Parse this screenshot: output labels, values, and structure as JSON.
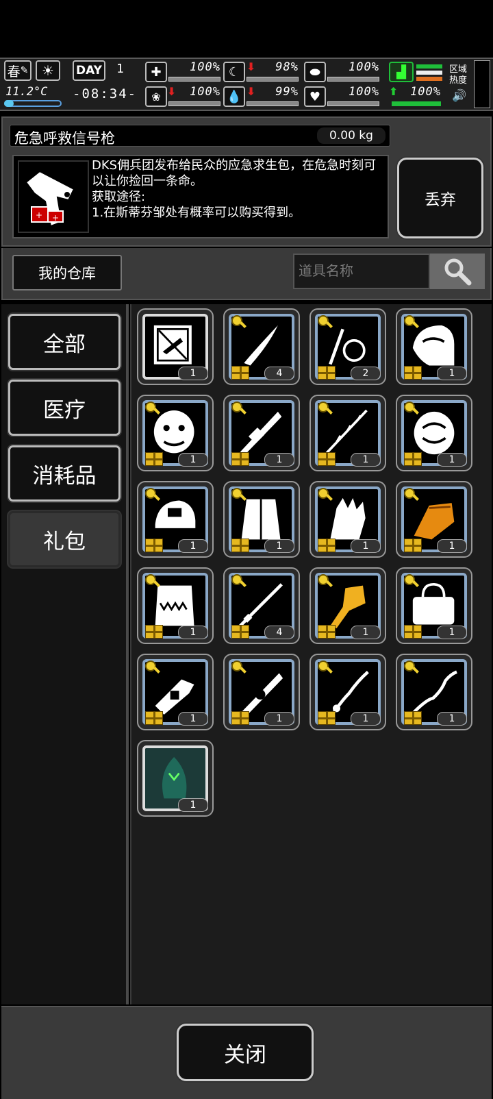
{
  "status": {
    "season": "春",
    "temperature": "11.2°C",
    "day_label": "DAY",
    "day_number": "1",
    "time": "-08:34-",
    "stats": [
      {
        "name": "health",
        "value": "100%"
      },
      {
        "name": "hunger",
        "value": "98%",
        "trend": "down"
      },
      {
        "name": "sleep",
        "value": "100%"
      },
      {
        "name": "mood",
        "value": "100%",
        "trend": "down"
      },
      {
        "name": "thirst",
        "value": "99%",
        "trend": "down"
      },
      {
        "name": "stamina",
        "value": "100%"
      }
    ],
    "boots_value": "100%",
    "region_heat_label": "区域\n热度"
  },
  "item": {
    "name": "危急呼救信号枪",
    "weight": "0.00 kg",
    "description": "DKS佣兵团发布给民众的应急求生包，在危急时刻可以让你捡回一条命。\n获取途径:\n1.在斯蒂芬邹处有概率可以购买得到。",
    "discard_label": "丢弃"
  },
  "warehouse": {
    "tab_label": "我的仓库",
    "search_placeholder": "道具名称"
  },
  "categories": [
    {
      "label": "全部",
      "active": false
    },
    {
      "label": "医疗",
      "active": false
    },
    {
      "label": "消耗品",
      "active": false
    },
    {
      "label": "礼包",
      "active": true
    }
  ],
  "inventory": [
    {
      "icon": "weapon-crate-icon",
      "count": "1",
      "gift": false
    },
    {
      "icon": "curved-blade-icon",
      "count": "4",
      "gift": true
    },
    {
      "icon": "whip-icon",
      "count": "2",
      "gift": true
    },
    {
      "icon": "helmet-icon",
      "count": "1",
      "gift": true
    },
    {
      "icon": "demon-mask-icon",
      "count": "1",
      "gift": true
    },
    {
      "icon": "ornate-rifle-icon",
      "count": "1",
      "gift": true
    },
    {
      "icon": "thorn-spear-icon",
      "count": "1",
      "gift": true
    },
    {
      "icon": "dragon-armor-icon",
      "count": "1",
      "gift": true
    },
    {
      "icon": "cap-icon",
      "count": "1",
      "gift": true
    },
    {
      "icon": "coat-icon",
      "count": "1",
      "gift": true
    },
    {
      "icon": "scale-glove-icon",
      "count": "1",
      "gift": true
    },
    {
      "icon": "gold-gauntlet-icon",
      "count": "1",
      "gift": true
    },
    {
      "icon": "fang-vest-icon",
      "count": "1",
      "gift": true
    },
    {
      "icon": "katana-icon",
      "count": "4",
      "gift": true
    },
    {
      "icon": "gold-dragon-gun-icon",
      "count": "1",
      "gift": true
    },
    {
      "icon": "bag-icon",
      "count": "1",
      "gift": true
    },
    {
      "icon": "heavy-gun-icon",
      "count": "1",
      "gift": true
    },
    {
      "icon": "mech-rifle-icon",
      "count": "1",
      "gift": true
    },
    {
      "icon": "serpent-blade-icon",
      "count": "1",
      "gift": true
    },
    {
      "icon": "wavy-sword-icon",
      "count": "1",
      "gift": true
    },
    {
      "icon": "green-creature-icon",
      "count": "1",
      "gift": false
    }
  ],
  "close_label": "关闭",
  "colors": {
    "panel": "#3a3a3a",
    "slot_frame": "#8aa8c8",
    "gold": "#e6b820",
    "bar_green": "#1fbf3a"
  }
}
